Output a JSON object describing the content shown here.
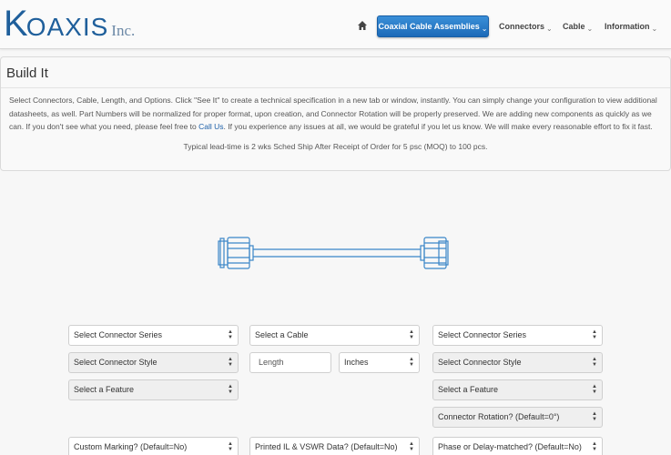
{
  "brand": {
    "k": "K",
    "rest": "OAXIS",
    "inc": "Inc."
  },
  "nav": {
    "home_icon": "home-icon",
    "active_label": "Coaxial Cable Assemblies",
    "links": [
      "Connectors",
      "Cable",
      "Information"
    ],
    "caret": "⌄"
  },
  "panel": {
    "title": "Build It",
    "body_part1": "Select Connectors, Cable, Length, and Options. Click \"See It\" to create a technical specification in a new tab or window, instantly. You can simply change your configuration to view additional datasheets, as well. Part Numbers will be normalized for proper format, upon creation, and Connector Rotation will be properly preserved. We are adding new components as quickly as we can. If you don't see what you need, please feel free to ",
    "link_label": "Call Us",
    "body_part2": ". If you experience any issues at all, we would be grateful if you let us know. We will make every reasonable effort to fix it fast.",
    "lead_time": "Typical lead-time is 2 wks Sched Ship After Receipt of Order for 5 psc (MOQ) to 100 pcs."
  },
  "colors": {
    "accent": "#1c6ab8",
    "brand": "#1f5f9b",
    "cable_line": "#3a86c8"
  },
  "form": {
    "left_series": "Select Connector Series",
    "left_style": "Select Connector Style",
    "left_feature": "Select a Feature",
    "cable": "Select a Cable",
    "length_placeholder": "Length",
    "units": "Inches",
    "right_series": "Select Connector Series",
    "right_style": "Select Connector Style",
    "right_feature": "Select a Feature",
    "rotation": "Connector Rotation? (Default=0°)",
    "marking": "Custom Marking? (Default=No)",
    "printed": "Printed IL & VSWR Data? (Default=No)",
    "phase": "Phase or Delay-matched? (Default=No)"
  }
}
